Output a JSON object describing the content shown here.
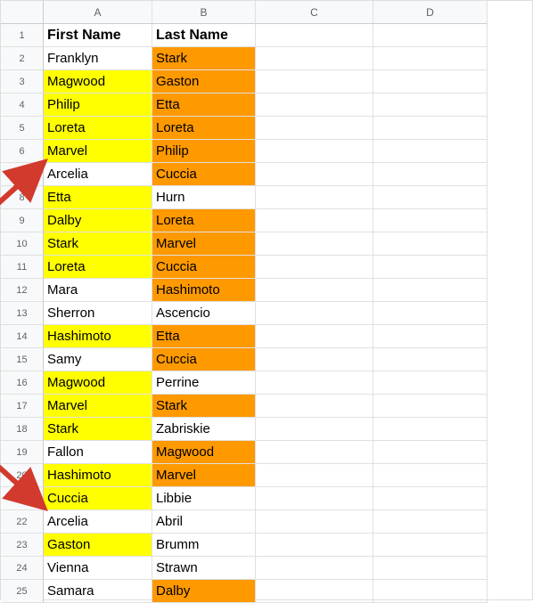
{
  "columns": [
    "A",
    "B",
    "C",
    "D"
  ],
  "header": {
    "first": "First Name",
    "last": "Last Name"
  },
  "rows": [
    {
      "n": 1,
      "a": "First Name",
      "b": "Last Name",
      "abold": true,
      "bbold": true
    },
    {
      "n": 2,
      "a": "Franklyn",
      "b": "Stark",
      "bhl": "orange"
    },
    {
      "n": 3,
      "a": "Magwood",
      "b": "Gaston",
      "ahl": "yellow",
      "bhl": "orange"
    },
    {
      "n": 4,
      "a": "Philip",
      "b": "Etta",
      "ahl": "yellow",
      "bhl": "orange"
    },
    {
      "n": 5,
      "a": "Loreta",
      "b": "Loreta",
      "ahl": "yellow",
      "bhl": "orange"
    },
    {
      "n": 6,
      "a": "Marvel",
      "b": "Philip",
      "ahl": "yellow",
      "bhl": "orange"
    },
    {
      "n": 7,
      "a": "Arcelia",
      "b": "Cuccia",
      "bhl": "orange"
    },
    {
      "n": 8,
      "a": "Etta",
      "b": "Hurn",
      "ahl": "yellow"
    },
    {
      "n": 9,
      "a": "Dalby",
      "b": "Loreta",
      "ahl": "yellow",
      "bhl": "orange"
    },
    {
      "n": 10,
      "a": "Stark",
      "b": "Marvel",
      "ahl": "yellow",
      "bhl": "orange"
    },
    {
      "n": 11,
      "a": "Loreta",
      "b": "Cuccia",
      "ahl": "yellow",
      "bhl": "orange"
    },
    {
      "n": 12,
      "a": "Mara",
      "b": "Hashimoto",
      "bhl": "orange"
    },
    {
      "n": 13,
      "a": "Sherron",
      "b": "Ascencio"
    },
    {
      "n": 14,
      "a": "Hashimoto",
      "b": "Etta",
      "ahl": "yellow",
      "bhl": "orange"
    },
    {
      "n": 15,
      "a": "Samy",
      "b": "Cuccia",
      "bhl": "orange"
    },
    {
      "n": 16,
      "a": "Magwood",
      "b": "Perrine",
      "ahl": "yellow"
    },
    {
      "n": 17,
      "a": "Marvel",
      "b": "Stark",
      "ahl": "yellow",
      "bhl": "orange"
    },
    {
      "n": 18,
      "a": "Stark",
      "b": "Zabriskie",
      "ahl": "yellow"
    },
    {
      "n": 19,
      "a": "Fallon",
      "b": "Magwood",
      "bhl": "orange"
    },
    {
      "n": 20,
      "a": "Hashimoto",
      "b": "Marvel",
      "ahl": "yellow",
      "bhl": "orange"
    },
    {
      "n": 21,
      "a": "Cuccia",
      "b": "Libbie",
      "ahl": "yellow"
    },
    {
      "n": 22,
      "a": "Arcelia",
      "b": "Abril"
    },
    {
      "n": 23,
      "a": "Gaston",
      "b": "Brumm",
      "ahl": "yellow"
    },
    {
      "n": 24,
      "a": "Vienna",
      "b": "Strawn"
    },
    {
      "n": 25,
      "a": "Samara",
      "b": "Dalby",
      "bhl": "orange"
    }
  ],
  "annotations": {
    "arrow1_target_row": 7,
    "arrow2_target_row": 22,
    "arrow_color": "#d23a2e"
  }
}
